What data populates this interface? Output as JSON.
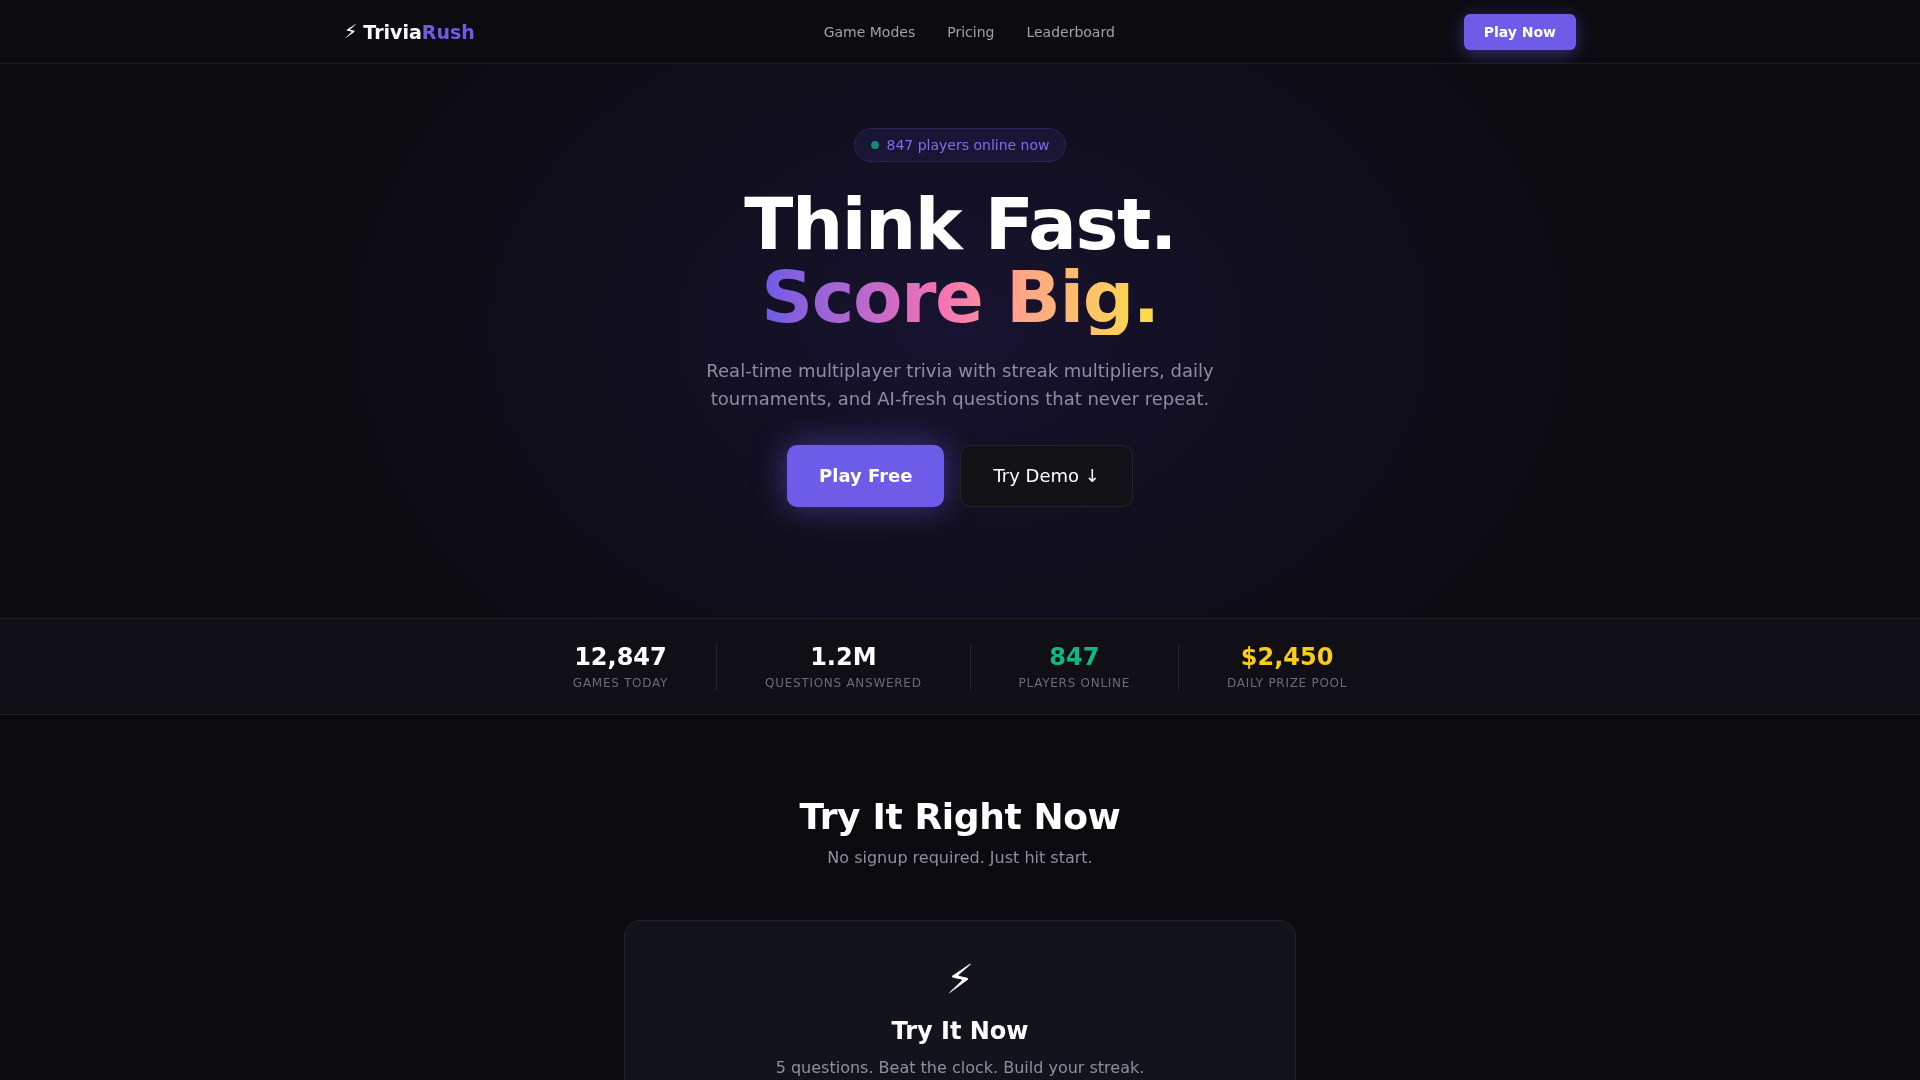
{
  "nav": {
    "logo": {
      "icon": "⚡",
      "name": "Trivia",
      "accent": "Rush"
    },
    "links": [
      "Game Modes",
      "Pricing",
      "Leaderboard"
    ],
    "cta": "Play Now"
  },
  "hero": {
    "badge": "847 players online now",
    "title": {
      "line": "Think Fast.",
      "highlight": "Score Big."
    },
    "subtitle": "Real-time multiplayer trivia with streak multipliers, daily tournaments, and AI-fresh questions that never repeat.",
    "buttons": [
      {
        "label": "Play Free",
        "kind": "primary"
      },
      {
        "label": "Try Demo ↓",
        "kind": "secondary"
      }
    ]
  },
  "stats": [
    {
      "value": "12,847",
      "label": "GAMES TODAY",
      "color": "#ffffff"
    },
    {
      "value": "1.2M",
      "label": "QUESTIONS ANSWERED",
      "color": "#ffffff"
    },
    {
      "value": "847",
      "label": "PLAYERS ONLINE",
      "color": "#10b981"
    },
    {
      "value": "$2,450",
      "label": "DAILY PRIZE POOL",
      "color": "#facc15"
    }
  ],
  "try_section": {
    "title": "Try It Right Now",
    "subtitle": "No signup required. Just hit start.",
    "card": {
      "icon": "⚡",
      "title": "Try It Now",
      "description": "5 questions. Beat the clock. Build your streak."
    }
  }
}
